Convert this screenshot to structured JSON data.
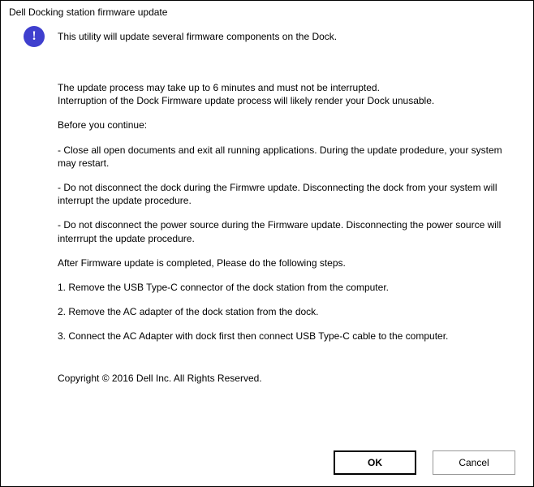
{
  "dialog": {
    "title": "Dell Docking station firmware update",
    "icon": "info-icon",
    "header_message": "This utility will update several firmware components on the Dock.",
    "paragraphs": [
      "The update process may take up to 6 minutes and must not be interrupted.\nInterruption of the Dock Firmware update process will likely render your Dock unusable.",
      "Before you continue:",
      "- Close all open documents and exit all running applications. During the update prodedure, your system may restart.",
      "- Do not disconnect the dock during the Firmwre update. Disconnecting the dock from your system will interrupt the update procedure.",
      "- Do not disconnect the power source during the Firmware update. Disconnecting the power source will interrrupt the update procedure.",
      "After Firmware update is completed, Please do the following steps.",
      "1. Remove the USB Type-C connector of the dock station from the computer.",
      "2. Remove the AC adapter of the dock station from the dock.",
      "3. Connect the AC Adapter with dock first then connect USB Type-C cable to the computer."
    ],
    "copyright": "Copyright © 2016 Dell Inc. All Rights Reserved.",
    "buttons": {
      "ok_label": "OK",
      "cancel_label": "Cancel"
    }
  }
}
